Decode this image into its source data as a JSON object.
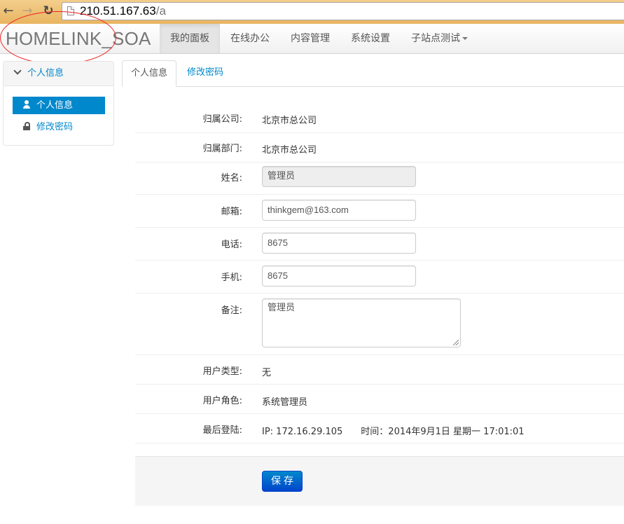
{
  "browser": {
    "url_host": "210.51.167.63",
    "url_path": "/a"
  },
  "navbar": {
    "brand": "HOMELINK_SOA",
    "items": [
      {
        "label": "我的面板",
        "active": true
      },
      {
        "label": "在线办公"
      },
      {
        "label": "内容管理"
      },
      {
        "label": "系统设置"
      },
      {
        "label": "子站点测试",
        "dropdown": true
      }
    ]
  },
  "sidebar": {
    "header": "个人信息",
    "items": [
      {
        "label": "个人信息",
        "icon": "user-icon",
        "active": true
      },
      {
        "label": "修改密码",
        "icon": "lock-icon"
      }
    ]
  },
  "tabs": [
    {
      "label": "个人信息",
      "active": true
    },
    {
      "label": "修改密码"
    }
  ],
  "form": {
    "company": {
      "label": "归属公司:",
      "value": "北京市总公司"
    },
    "department": {
      "label": "归属部门:",
      "value": "北京市总公司"
    },
    "name": {
      "label": "姓名:",
      "value": "管理员"
    },
    "email": {
      "label": "邮箱:",
      "value": "thinkgem@163.com"
    },
    "phone": {
      "label": "电话:",
      "value": "8675"
    },
    "mobile": {
      "label": "手机:",
      "value": "8675"
    },
    "remarks": {
      "label": "备注:",
      "value": "管理员"
    },
    "user_type": {
      "label": "用户类型:",
      "value": "无"
    },
    "user_role": {
      "label": "用户角色:",
      "value": "系统管理员"
    },
    "last_login": {
      "label": "最后登陆:",
      "value": "IP: 172.16.29.105　　时间：2014年9月1日 星期一 17:01:01"
    }
  },
  "actions": {
    "save_label": "保存"
  },
  "colors": {
    "link": "#0088cc",
    "primary_button": "#0044cc",
    "annotation_circle": "#ee2222"
  }
}
